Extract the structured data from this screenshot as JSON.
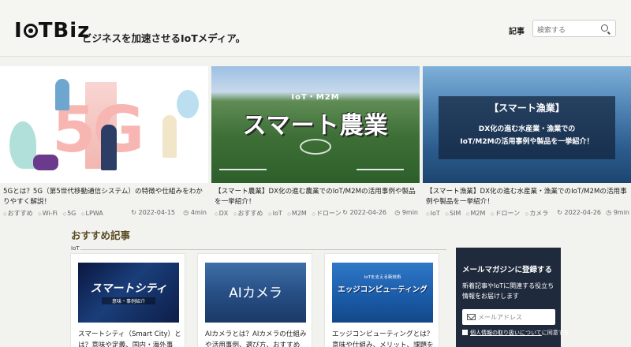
{
  "header": {
    "logo": "IoTBiz",
    "tagline": "ビジネスを加速させるIoTメディア。",
    "nav_articles": "記事",
    "search_placeholder": "検索する"
  },
  "featured": [
    {
      "title": "5Gとは？5G（第5世代移動通信システム）の特徴や仕組みをわかりやすく解説！",
      "tags": [
        "おすすめ",
        "Wi-Fi",
        "5G",
        "LPWA"
      ],
      "date": "2022-04-15",
      "read_time": "4min",
      "thumb_text": "5G"
    },
    {
      "title": "【スマート農業】DX化の進む農業でのIoT/M2Mの活用事例や製品を一挙紹介！",
      "tags": [
        "DX",
        "おすすめ",
        "IoT",
        "M2M",
        "ドローン"
      ],
      "date": "2022-04-26",
      "read_time": "9min",
      "thumb_sub": "IoT・M2M",
      "thumb_text": "スマート農業"
    },
    {
      "title": "【スマート漁業】DX化の進む水産業・漁業でのIoT/M2Mの活用事例や製品を一挙紹介！",
      "tags": [
        "IoT",
        "SIM",
        "M2M",
        "ドローン",
        "カメラ"
      ],
      "date": "2022-04-26",
      "read_time": "9min",
      "thumb_heading": "【スマート漁業】",
      "thumb_line1": "DX化の進む水産業・漁業での",
      "thumb_line2": "IoT/M2Mの活用事例や製品を一挙紹介！"
    }
  ],
  "recommended": {
    "heading": "おすすめ記事",
    "category": "IoT",
    "cards": [
      {
        "title": "スマートシティ（Smart City）とは？意味や定義、国内・海外事例...",
        "thumb_text": "スマートシティ",
        "thumb_sub": "意味・事例紹介"
      },
      {
        "title": "AIカメラとは？AIカメラの仕組みや活用事例、選び方、おすすめの...",
        "thumb_text": "AIカメラ"
      },
      {
        "title": "エッジコンピューティングとは？意味や仕組み、メリット、課題を徹...",
        "thumb_sub": "IoTを支える新技術",
        "thumb_text": "エッジコンピューティング"
      }
    ]
  },
  "newsletter": {
    "title": "メールマガジンに登録する",
    "description": "新着記事やIoTに関連する役立ち情報をお届けします",
    "email_placeholder": "メールアドレス",
    "agree_link": "個人情報の取り扱いについて",
    "agree_suffix": "に同意する"
  },
  "colors": {
    "background": "#f2f2ef",
    "heading_accent": "#5a4a22",
    "newsletter_bg": "#1f2a3c"
  }
}
